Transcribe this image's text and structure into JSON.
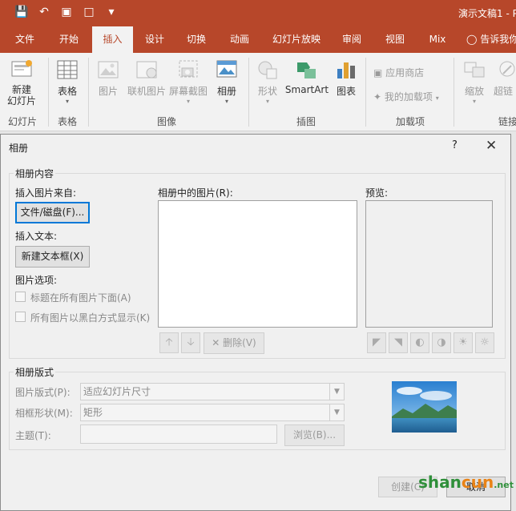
{
  "colors": {
    "accent": "#b7472a",
    "ribbon": "#f2f2f2",
    "dialog": "#f0f0f0",
    "focus": "#0078d7"
  },
  "qat": {
    "icons": [
      "save-icon",
      "undo-icon",
      "slideshow-icon",
      "new-doc-icon",
      "customize-icon"
    ]
  },
  "window": {
    "title": "演示文稿1 - P"
  },
  "tabs": [
    "文件",
    "开始",
    "插入",
    "设计",
    "切换",
    "动画",
    "幻灯片放映",
    "审阅",
    "视图",
    "Mix",
    "告诉我你"
  ],
  "ribbon": {
    "new_slide": "新建\n幻灯片",
    "table": "表格",
    "images": [
      "图片",
      "联机图片",
      "屏幕截图",
      "相册"
    ],
    "illustrations": [
      "形状",
      "SmartArt",
      "图表"
    ],
    "addins": [
      "应用商店",
      "我的加载项"
    ],
    "links": [
      "缩放",
      "超链"
    ],
    "groups": {
      "slides": "幻灯片",
      "tables": "表格",
      "images": "图像",
      "illustrations": "插图",
      "addins": "加载项",
      "links": "链接"
    }
  },
  "dialog": {
    "title": "相册",
    "help": "?",
    "close": "✕",
    "content_legend": "相册内容",
    "insert_from": "插入图片来自:",
    "file_button": "文件/磁盘(F)...",
    "insert_text": "插入文本:",
    "new_textbox": "新建文本框(X)",
    "picture_options": "图片选项:",
    "option_captions": "标题在所有图片下面(A)",
    "option_bw": "所有图片以黑白方式显示(K)",
    "pictures_in_album": "相册中的图片(R):",
    "preview": "预览:",
    "delete": "删除(V)",
    "layout_legend": "相册版式",
    "picture_layout_label": "图片版式(P):",
    "picture_layout_value": "适应幻灯片尺寸",
    "frame_label": "相框形状(M):",
    "frame_value": "矩形",
    "theme_label": "主题(T):",
    "browse": "浏览(B)...",
    "create": "创建(C)",
    "cancel": "取消"
  },
  "watermark": {
    "a": "shan",
    "b": "cun",
    "c": ".net"
  }
}
